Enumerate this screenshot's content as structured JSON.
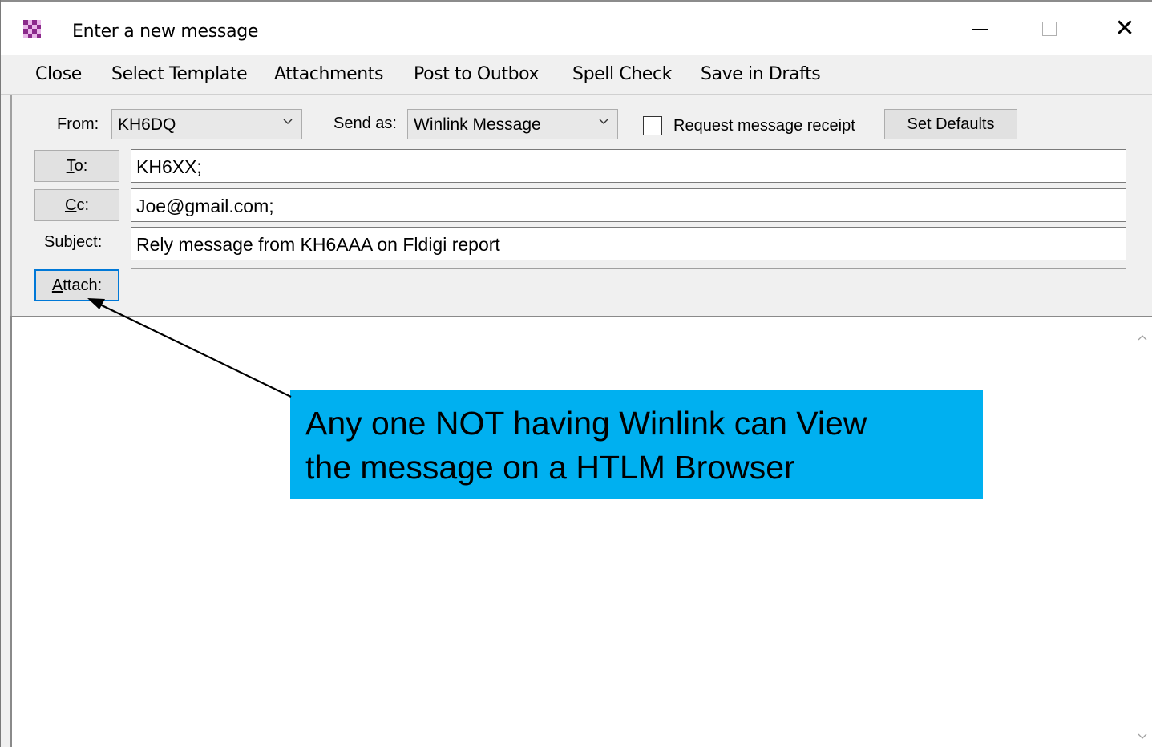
{
  "window": {
    "title": "Enter a new message",
    "controls": [
      "minimize",
      "maximize",
      "close"
    ]
  },
  "menu": {
    "items": [
      "Close",
      "Select Template",
      "Attachments",
      "Post to Outbox",
      "Spell Check",
      "Save in Drafts"
    ]
  },
  "header": {
    "from_label": "From:",
    "from_value": "KH6DQ",
    "send_as_label": "Send as:",
    "send_as_value": "Winlink Message",
    "request_receipt_label": "Request message receipt",
    "request_receipt_checked": false,
    "set_defaults_label": "Set Defaults",
    "to_button": "To:",
    "to_value": "KH6XX;",
    "cc_button": "Cc:",
    "cc_value": "Joe@gmail.com;",
    "subject_label": "Subject:",
    "subject_value": "Rely message from KH6AAA on Fldigi report",
    "attach_button": "Attach:",
    "attach_value": ""
  },
  "body": {
    "text": ""
  },
  "annotation": {
    "line1": "Any one NOT having Winlink can View",
    "line2": "the message on a HTLM Browser",
    "color": "#00b0f0"
  }
}
